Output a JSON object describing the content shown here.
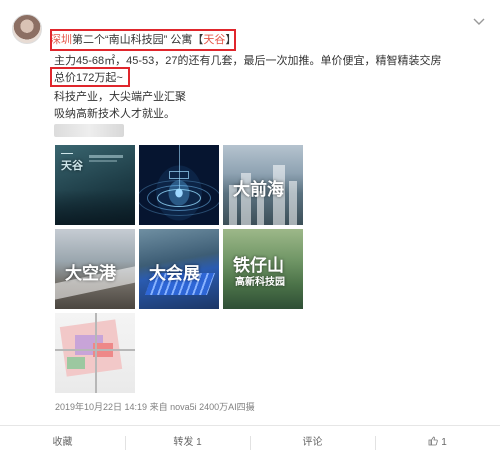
{
  "post": {
    "city_tag": "深圳",
    "title_mid": "第二个“南山科技园” 公寓【",
    "project_tag": "天谷",
    "title_end": "】",
    "line2": "主力45-68㎡，45-53，27的还有几套，最后一次加推。单价便宜，精智精装交房",
    "price": "总价172万起~",
    "line4": "科技产业，大尖端产业汇聚",
    "line5": "吸纳高新技术人才就业。"
  },
  "images": {
    "tile1_brand": "天谷",
    "tile3_caption": "大前海",
    "tile4_caption": "大空港",
    "tile5_caption": "大会展",
    "tile6_caption": "铁仔山",
    "tile6_subcaption": "高新科技园"
  },
  "meta": "2019年10月22日 14:19  来自 nova5i 2400万AI四摄",
  "actions": {
    "favorite": "收藏",
    "repost": "转发 1",
    "comment": "评论",
    "like_count": "1"
  },
  "colors": {
    "highlight_box": "#e0262c",
    "link": "#eb7350"
  }
}
